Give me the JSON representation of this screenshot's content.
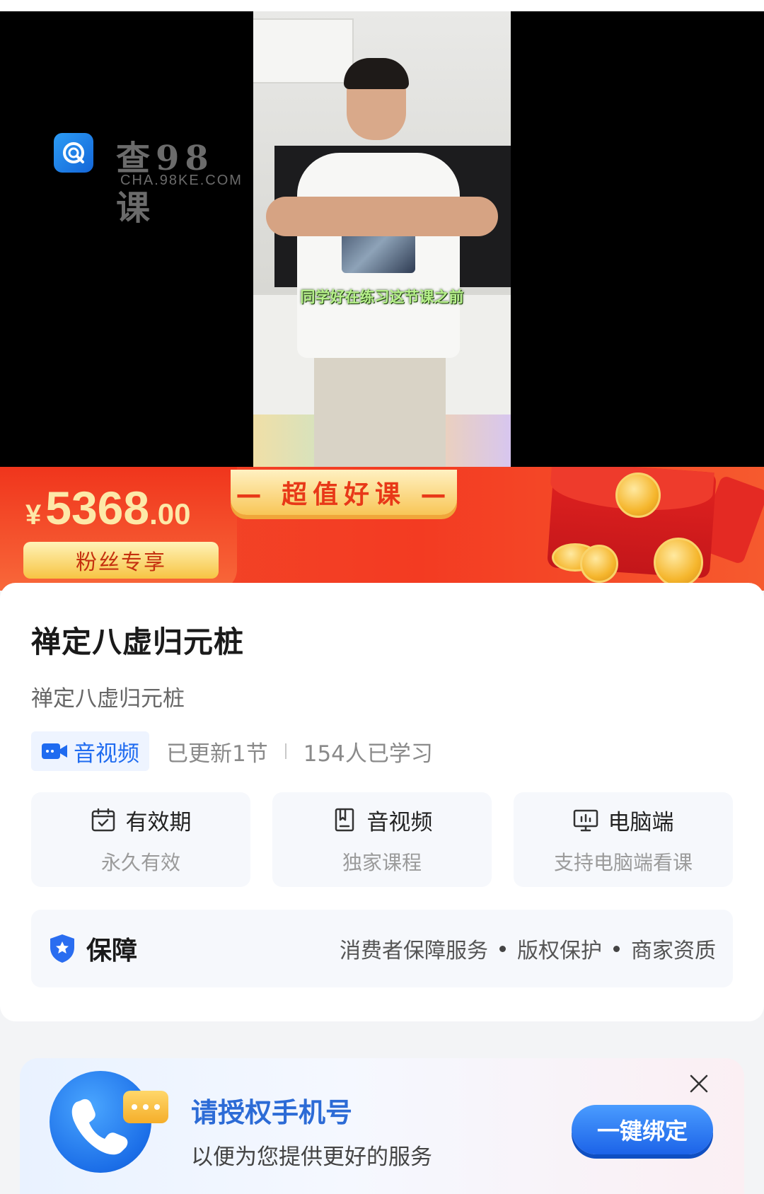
{
  "video": {
    "subtitle": "同学好在练习这节课之前",
    "watermark": {
      "title": "查98课",
      "sub": "CHA.98KE.COM"
    }
  },
  "promo": {
    "currency": "¥",
    "price_int": "5368",
    "price_dec": ".00",
    "fans_label": "粉丝专享",
    "ribbon_label": "— 超值好课 —"
  },
  "course": {
    "title": "禅定八虚归元桩",
    "subtitle": "禅定八虚归元桩",
    "type_tag": "音视频",
    "updated": "已更新1节",
    "learners": "154人已学习"
  },
  "features": [
    {
      "label": "有效期",
      "sub": "永久有效",
      "icon": "calendar-icon"
    },
    {
      "label": "音视频",
      "sub": "独家课程",
      "icon": "book-icon"
    },
    {
      "label": "电脑端",
      "sub": "支持电脑端看课",
      "icon": "monitor-icon"
    }
  ],
  "guarantee": {
    "label": "保障",
    "items": [
      "消费者保障服务",
      "版权保护",
      "商家资质"
    ]
  },
  "bind": {
    "title": "请授权手机号",
    "subtitle": "以便为您提供更好的服务",
    "button": "一键绑定"
  },
  "colors": {
    "accent_blue": "#1f6bf0",
    "promo_red": "#f33b22",
    "gold": "#f7c443"
  }
}
